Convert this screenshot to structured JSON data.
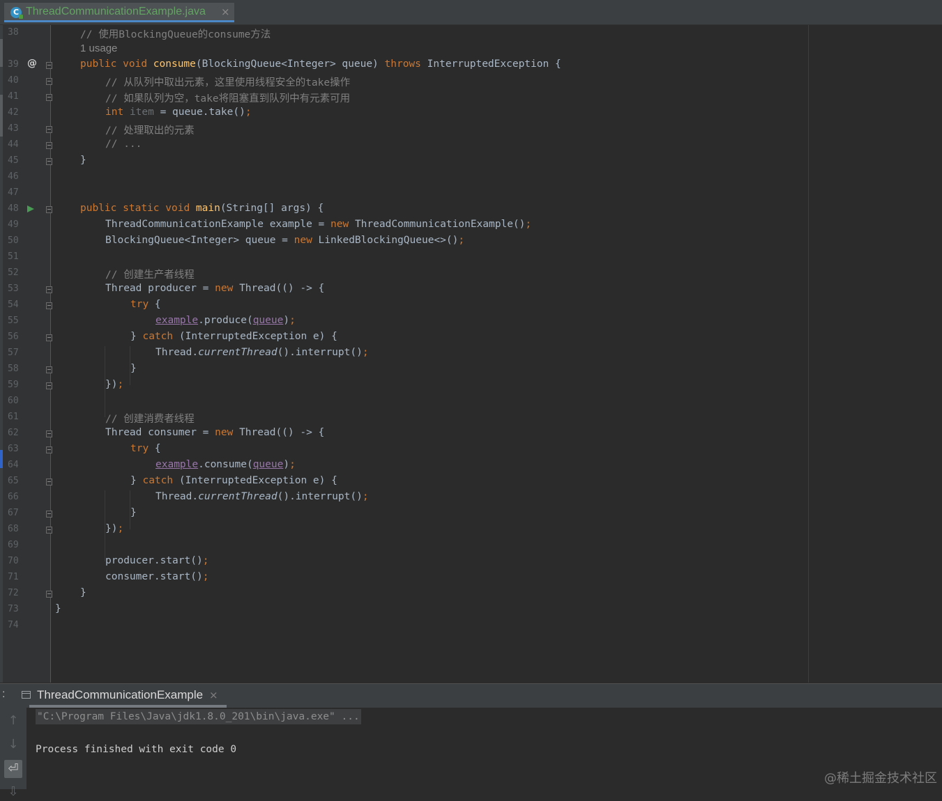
{
  "tab": {
    "filename": "ThreadCommunicationExample.java",
    "close": "×",
    "class_icon": "C"
  },
  "editor": {
    "line_numbers": [
      "38",
      "39",
      "40",
      "41",
      "42",
      "43",
      "44",
      "45",
      "46",
      "47",
      "48",
      "49",
      "50",
      "51",
      "52",
      "53",
      "54",
      "55",
      "56",
      "57",
      "58",
      "59",
      "60",
      "61",
      "62",
      "63",
      "64",
      "65",
      "66",
      "67",
      "68",
      "69",
      "70",
      "71",
      "72",
      "73",
      "74"
    ],
    "usage_hint": "1 usage",
    "text": {
      "l38_comment": "// 使用BlockingQueue的consume方法",
      "l39_public": "public",
      "l39_void": "void",
      "l39_name": "consume",
      "l39_params": "(BlockingQueue<Integer> queue) ",
      "l39_throws": "throws",
      "l39_rest": " InterruptedException {",
      "l40": "// 从队列中取出元素，这里使用线程安全的take操作",
      "l41": "// 如果队列为空，take将阻塞直到队列中有元素可用",
      "l42_int": "int",
      "l42_item": "item",
      "l42_rest": " = queue.take()",
      "semi": ";",
      "l43": "// 处理取出的元素",
      "l44": "// ...",
      "close_brace": "}",
      "l48_public": "public",
      "l48_static": "static",
      "l48_void": "void",
      "l48_main": "main",
      "l48_rest": "(String[] args) {",
      "l49_a": "ThreadCommunicationExample example = ",
      "new": "new",
      "l49_b": " ThreadCommunicationExample()",
      "l50_a": "BlockingQueue<Integer> queue = ",
      "l50_b": " LinkedBlockingQueue<>()",
      "l52": "// 创建生产者线程",
      "l53_a": "Thread producer = ",
      "thread_lambda": " Thread(() -> {",
      "try": "try",
      "open_brace": " {",
      "example": "example",
      "queue": "queue",
      "produce_call": ".produce(",
      "consume_call": ".consume(",
      "close_paren": ")",
      "catch_open": "} ",
      "catch": "catch",
      "catch_rest": " (InterruptedException e) {",
      "thread_dot": "Thread.",
      "current_thread": "currentThread",
      "interrupt": "().interrupt()",
      "lambda_close": "})",
      "l61": "// 创建消费者线程",
      "l62_a": "Thread consumer = ",
      "l70": "producer.start()",
      "l71": "consumer.start()"
    }
  },
  "run_panel": {
    "prefix": ":",
    "tab_label": "ThreadCommunicationExample",
    "close": "×",
    "command": "\"C:\\Program Files\\Java\\jdk1.8.0_201\\bin\\java.exe\" ...",
    "output": "Process finished with exit code 0",
    "tools": {
      "up": "↑",
      "down": "↓",
      "wrap": "⏎",
      "print": "⇩"
    }
  },
  "watermark": "@稀土掘金技术社区"
}
